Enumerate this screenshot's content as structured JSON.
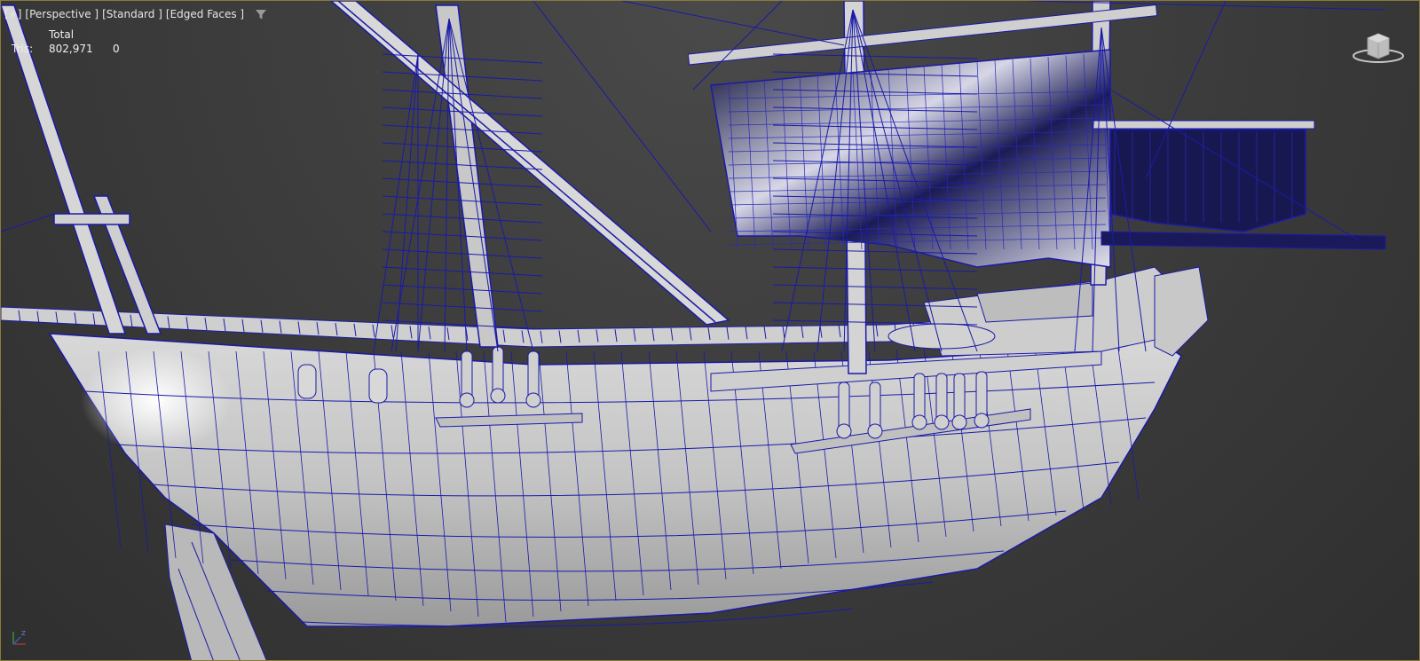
{
  "viewport": {
    "labels": [
      "[+]",
      "[Perspective ]",
      "[Standard ]",
      "[Edged Faces ]"
    ],
    "filter_icon": "filter-funnel-icon",
    "axis_label": "Z"
  },
  "stats": {
    "column_header": "Total",
    "row_label": "Tris:",
    "total": "802,971",
    "selected": "0"
  },
  "colors": {
    "wire": "#1a1aa8",
    "hull": "#c9c9c9",
    "background": "#3a3a3a",
    "sail": "#1b1b4a"
  }
}
